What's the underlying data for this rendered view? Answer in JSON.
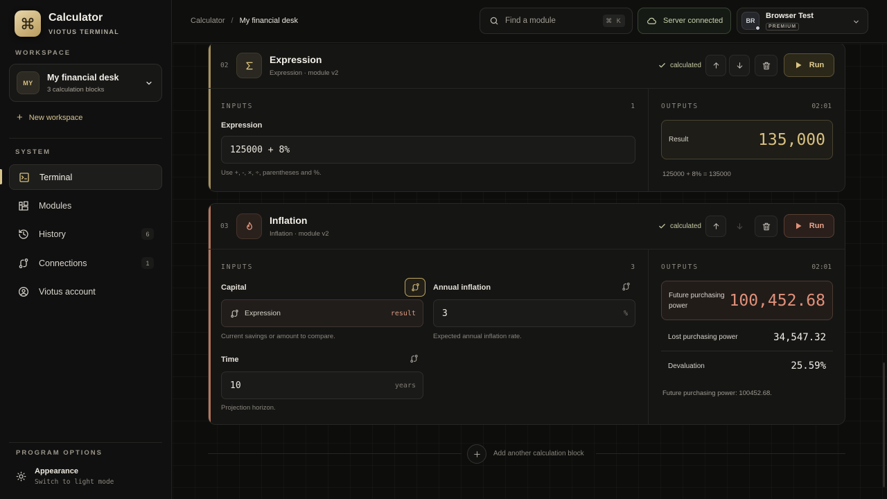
{
  "brand": {
    "name": "Calculator",
    "subtitle": "VIOTUS TERMINAL"
  },
  "sidebar": {
    "workspace_label": "WORKSPACE",
    "workspace": {
      "avatar": "MY",
      "name": "My financial desk",
      "count": "3 calculation blocks"
    },
    "new_workspace": "New workspace",
    "system_label": "SYSTEM",
    "nav": [
      {
        "label": "Terminal",
        "icon": "terminal-icon",
        "badge": ""
      },
      {
        "label": "Modules",
        "icon": "modules-icon",
        "badge": ""
      },
      {
        "label": "History",
        "icon": "history-icon",
        "badge": "6"
      },
      {
        "label": "Connections",
        "icon": "connections-icon",
        "badge": "1"
      },
      {
        "label": "Viotus account",
        "icon": "account-icon",
        "badge": ""
      }
    ],
    "options_label": "PROGRAM OPTIONS",
    "appearance": {
      "title": "Appearance",
      "subtitle": "Switch to light mode"
    }
  },
  "header": {
    "breadcrumb": [
      "Calculator",
      "My financial desk"
    ],
    "search_placeholder": "Find a module",
    "shortcut": "⌘ K",
    "server_status": "Server connected",
    "user": {
      "initials": "BR",
      "name": "Browser Test",
      "badge": "PREMIUM"
    }
  },
  "blocks": [
    {
      "number": "02",
      "title": "Expression",
      "subtitle": "Expression · module v2",
      "status": "calculated",
      "run_label": "Run",
      "accent": "#a8925a",
      "inputs_label": "INPUTS",
      "inputs_count": "1",
      "outputs_label": "OUTPUTS",
      "outputs_time": "02:01",
      "field_label": "Expression",
      "field_value": "125000 + 8%",
      "hint": "Use +, -, ×, ÷, parentheses and %.",
      "result_label": "Result",
      "result_value": "135,000",
      "summary": "125000 + 8% = 135000"
    },
    {
      "number": "03",
      "title": "Inflation",
      "subtitle": "Inflation · module v2",
      "status": "calculated",
      "run_label": "Run",
      "accent": "#b8765c",
      "inputs_label": "INPUTS",
      "inputs_count": "3",
      "outputs_label": "OUTPUTS",
      "outputs_time": "02:01",
      "capital": {
        "label": "Capital",
        "source": "Expression",
        "tag": "result",
        "hint": "Current savings or amount to compare."
      },
      "inflation": {
        "label": "Annual inflation",
        "value": "3",
        "unit": "%",
        "hint": "Expected annual inflation rate."
      },
      "time": {
        "label": "Time",
        "value": "10",
        "unit": "years",
        "hint": "Projection horizon."
      },
      "primary": {
        "label": "Future purchasing power",
        "value": "100,452.68"
      },
      "rows": [
        {
          "label": "Lost purchasing power",
          "value": "34,547.32"
        },
        {
          "label": "Devaluation",
          "value": "25.59%"
        }
      ],
      "summary": "Future purchasing power: 100452.68."
    }
  ],
  "add_block": "Add another calculation block",
  "colors": {
    "gold": "#d8c07f",
    "copper": "#e0917a",
    "background": "#0d0d0c"
  }
}
